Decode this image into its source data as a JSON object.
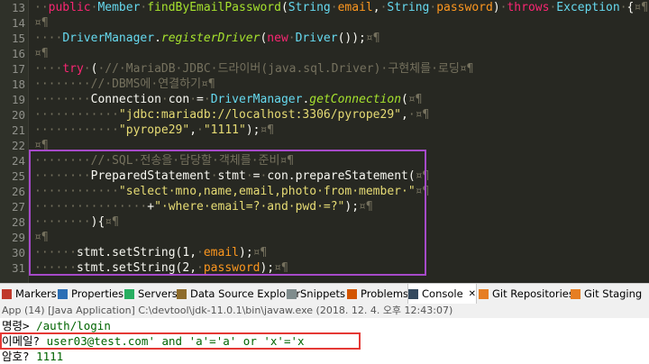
{
  "editor": {
    "lines": [
      {
        "num": "13",
        "segs": [
          [
            "ws",
            "··"
          ],
          [
            "kw",
            "public"
          ],
          [
            "ws",
            "·"
          ],
          [
            "ty",
            "Member"
          ],
          [
            "ws",
            "·"
          ],
          [
            "fn",
            "findByEmailPassword"
          ],
          [
            "pl",
            "("
          ],
          [
            "ty",
            "String"
          ],
          [
            "ws",
            "·"
          ],
          [
            "pm",
            "email"
          ],
          [
            "pl",
            ","
          ],
          [
            "ws",
            "·"
          ],
          [
            "ty",
            "String"
          ],
          [
            "ws",
            "·"
          ],
          [
            "pm",
            "password"
          ],
          [
            "pl",
            ")"
          ],
          [
            "ws",
            "·"
          ],
          [
            "kw",
            "throws"
          ],
          [
            "ws",
            "·"
          ],
          [
            "ty",
            "Exception"
          ],
          [
            "ws",
            "·"
          ],
          [
            "pl",
            "{"
          ],
          [
            "ws",
            "¤¶"
          ]
        ]
      },
      {
        "num": "14",
        "segs": [
          [
            "ws",
            "¤¶"
          ]
        ]
      },
      {
        "num": "15",
        "segs": [
          [
            "ws",
            "····"
          ],
          [
            "ty",
            "DriverManager"
          ],
          [
            "pl",
            "."
          ],
          [
            "fi",
            "registerDriver"
          ],
          [
            "pl",
            "("
          ],
          [
            "kw",
            "new"
          ],
          [
            "ws",
            "·"
          ],
          [
            "ty",
            "Driver"
          ],
          [
            "pl",
            "());"
          ],
          [
            "ws",
            "¤¶"
          ]
        ]
      },
      {
        "num": "16",
        "segs": [
          [
            "ws",
            "¤¶"
          ]
        ]
      },
      {
        "num": "17",
        "segs": [
          [
            "ws",
            "····"
          ],
          [
            "kw",
            "try"
          ],
          [
            "ws",
            "·"
          ],
          [
            "pl",
            "("
          ],
          [
            "ws",
            "·"
          ],
          [
            "cm",
            "//·MariaDB·JDBC·드라이버(java.sql.Driver)·구현체를·로딩"
          ],
          [
            "ws",
            "¤¶"
          ]
        ]
      },
      {
        "num": "18",
        "segs": [
          [
            "ws",
            "········"
          ],
          [
            "cm",
            "//·DBMS에·연결하기"
          ],
          [
            "ws",
            "¤¶"
          ]
        ]
      },
      {
        "num": "19",
        "segs": [
          [
            "ws",
            "········"
          ],
          [
            "pl",
            "Connection"
          ],
          [
            "ws",
            "·"
          ],
          [
            "pl",
            "con"
          ],
          [
            "ws",
            "·"
          ],
          [
            "pl",
            "="
          ],
          [
            "ws",
            "·"
          ],
          [
            "ty",
            "DriverManager"
          ],
          [
            "pl",
            "."
          ],
          [
            "fi",
            "getConnection"
          ],
          [
            "pl",
            "("
          ],
          [
            "ws",
            "¤¶"
          ]
        ]
      },
      {
        "num": "20",
        "segs": [
          [
            "ws",
            "············"
          ],
          [
            "st",
            "\"jdbc:mariadb://localhost:3306/pyrope29\""
          ],
          [
            "pl",
            ","
          ],
          [
            "ws",
            "·¤¶"
          ]
        ]
      },
      {
        "num": "21",
        "segs": [
          [
            "ws",
            "············"
          ],
          [
            "st",
            "\"pyrope29\""
          ],
          [
            "pl",
            ","
          ],
          [
            "ws",
            "·"
          ],
          [
            "st",
            "\"1111\""
          ],
          [
            "pl",
            ");"
          ],
          [
            "ws",
            "¤¶"
          ]
        ]
      },
      {
        "num": "22",
        "segs": [
          [
            "ws",
            "¤¶"
          ]
        ]
      },
      {
        "num": "24",
        "segs": [
          [
            "ws",
            "········"
          ],
          [
            "cm",
            "//·SQL·전송을·담당할·객체를·준비"
          ],
          [
            "ws",
            "¤¶"
          ]
        ]
      },
      {
        "num": "25",
        "segs": [
          [
            "ws",
            "········"
          ],
          [
            "pl",
            "PreparedStatement"
          ],
          [
            "ws",
            "·"
          ],
          [
            "pl",
            "stmt"
          ],
          [
            "ws",
            "·"
          ],
          [
            "pl",
            "="
          ],
          [
            "ws",
            "·"
          ],
          [
            "pl",
            "con.prepareStatement("
          ],
          [
            "ws",
            "¤¶"
          ]
        ]
      },
      {
        "num": "26",
        "segs": [
          [
            "ws",
            "············"
          ],
          [
            "st",
            "\"select·mno,name,email,photo·from·member·\""
          ],
          [
            "ws",
            "¤¶"
          ]
        ]
      },
      {
        "num": "27",
        "segs": [
          [
            "ws",
            "················"
          ],
          [
            "pl",
            "+"
          ],
          [
            "st",
            "\"·where·email=?·and·pwd·=?\""
          ],
          [
            "pl",
            ");"
          ],
          [
            "ws",
            "¤¶"
          ]
        ]
      },
      {
        "num": "28",
        "segs": [
          [
            "ws",
            "········"
          ],
          [
            "pl",
            "){"
          ],
          [
            "ws",
            "¤¶"
          ]
        ]
      },
      {
        "num": "29",
        "segs": [
          [
            "ws",
            "¤¶"
          ]
        ]
      },
      {
        "num": "30",
        "segs": [
          [
            "ws",
            "······"
          ],
          [
            "pl",
            "stmt.setString(1,"
          ],
          [
            "ws",
            "·"
          ],
          [
            "pm",
            "email"
          ],
          [
            "pl",
            ");"
          ],
          [
            "ws",
            "¤¶"
          ]
        ]
      },
      {
        "num": "31",
        "segs": [
          [
            "ws",
            "······"
          ],
          [
            "pl",
            "stmt.setString(2,"
          ],
          [
            "ws",
            "·"
          ],
          [
            "pm",
            "password"
          ],
          [
            "pl",
            ");"
          ],
          [
            "ws",
            "¤¶"
          ]
        ]
      }
    ]
  },
  "tabs": [
    {
      "label": "Markers",
      "icon": "markers-icon",
      "color": "#c0392b",
      "active": false
    },
    {
      "label": "Properties",
      "icon": "properties-icon",
      "color": "#2c6fb5",
      "active": false
    },
    {
      "label": "Servers",
      "icon": "servers-icon",
      "color": "#27ae60",
      "active": false
    },
    {
      "label": "Data Source Explorer",
      "icon": "data-source-icon",
      "color": "#8e6c2b",
      "active": false
    },
    {
      "label": "Snippets",
      "icon": "snippets-icon",
      "color": "#7f8c8d",
      "active": false
    },
    {
      "label": "Problems",
      "icon": "problems-icon",
      "color": "#d35400",
      "active": false
    },
    {
      "label": "Console",
      "icon": "console-icon",
      "color": "#34495e",
      "active": true
    },
    {
      "label": "Git Repositories",
      "icon": "git-repositories-icon",
      "color": "#e67e22",
      "active": false
    },
    {
      "label": "Git Staging",
      "icon": "git-staging-icon",
      "color": "#e67e22",
      "active": false
    }
  ],
  "console_close": "✕",
  "status_text": "App (14) [Java Application] C:\\devtool\\jdk-11.0.1\\bin\\javaw.exe (2018. 12. 4. 오후 12:43:07)",
  "console": {
    "line1_prompt": "명령> ",
    "line1_input": "/auth/login",
    "line2_prompt": "이메일? ",
    "line2_input": "user03@test.com' and 'a'='a' or 'x'='x",
    "line3_prompt": "암호? ",
    "line3_input": "1111"
  },
  "colors": {
    "highlight_box": "#a64ac9",
    "console_box": "#e53935"
  }
}
